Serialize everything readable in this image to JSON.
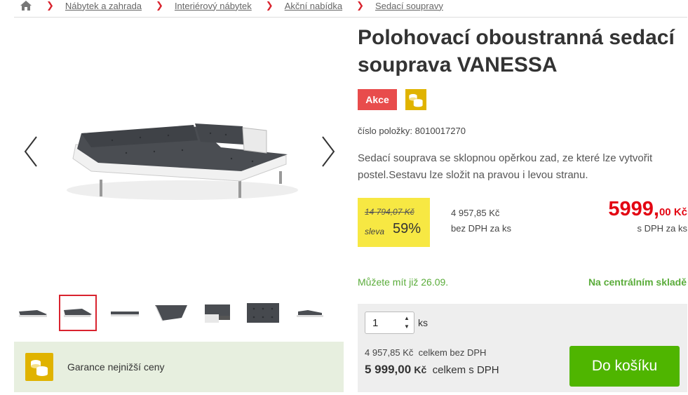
{
  "breadcrumb": {
    "items": [
      "Nábytek a zahrada",
      "Interiérový nábytek",
      "Akční nabídka",
      "Sedací soupravy"
    ]
  },
  "gallery": {
    "thumbnail_count": 7,
    "active_thumbnail": 2
  },
  "guarantee": {
    "text": "Garance nejnižší ceny"
  },
  "product": {
    "title": "Polohovací oboustranná sedací souprava VANESSA",
    "badge_sale": "Akce",
    "item_number": "číslo položky: 8010017270",
    "description": "Sedací souprava se sklopnou opěrkou zad, ze které lze vytvořit postel.Sestavu lze složit na pravou i levou stranu."
  },
  "pricing": {
    "old_price": "14 794,07 Kč",
    "discount_label": "sleva",
    "discount_value": "59%",
    "net_price": "4 957,85 Kč",
    "net_label": "bez DPH za ks",
    "final_price_main": "5999,",
    "final_price_decimals": "00 Kč",
    "vat_label": "s DPH za ks"
  },
  "availability": {
    "delivery": "Můžete mít již 26.09.",
    "stock": "Na centrálním skladě"
  },
  "cart": {
    "quantity": "1",
    "unit": "ks",
    "total_net_value": "4 957,85 Kč",
    "total_net_label": "celkem bez DPH",
    "total_gross_value": "5 999,00",
    "total_gross_currency": "Kč",
    "total_gross_label": "celkem s DPH",
    "add_button": "Do košíku"
  },
  "colors": {
    "accent_red": "#e30613",
    "sale_badge": "#e84c4c",
    "discount_yellow": "#f7e843",
    "coin_gold": "#e0b300",
    "success_green": "#5aac3a",
    "button_green": "#4fb500",
    "guarantee_bg": "#e7efdf"
  }
}
